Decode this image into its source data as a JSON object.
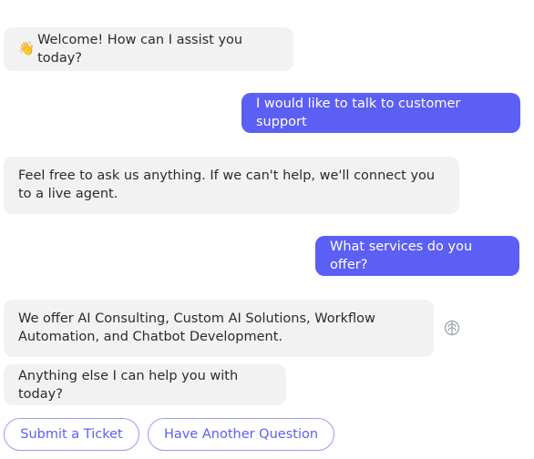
{
  "messages": [
    {
      "role": "bot",
      "emoji": "👋",
      "text": "Welcome! How can I assist you today?"
    },
    {
      "role": "user",
      "text": "I would like to talk to customer support"
    },
    {
      "role": "bot",
      "text": "Feel free to ask us anything. If we can't help, we'll connect you to a live agent."
    },
    {
      "role": "user",
      "text": "What services do you offer?"
    },
    {
      "role": "bot",
      "text": "We offer AI Consulting, Custom AI Solutions, Workflow Automation, and Chatbot Development."
    },
    {
      "role": "bot",
      "text": "Anything else I can help you with today?"
    }
  ],
  "quick_replies": [
    {
      "label": "Submit a Ticket"
    },
    {
      "label": "Have Another Question"
    }
  ],
  "icons": {
    "ai_indicator": "brain-icon"
  },
  "colors": {
    "accent": "#5b5ff3",
    "bot_bubble": "#f2f2f3",
    "bot_text": "#2b2b2e",
    "user_text": "#ffffff",
    "quick_reply_border": "#9a9cf1",
    "icon": "#9aa0aa"
  }
}
